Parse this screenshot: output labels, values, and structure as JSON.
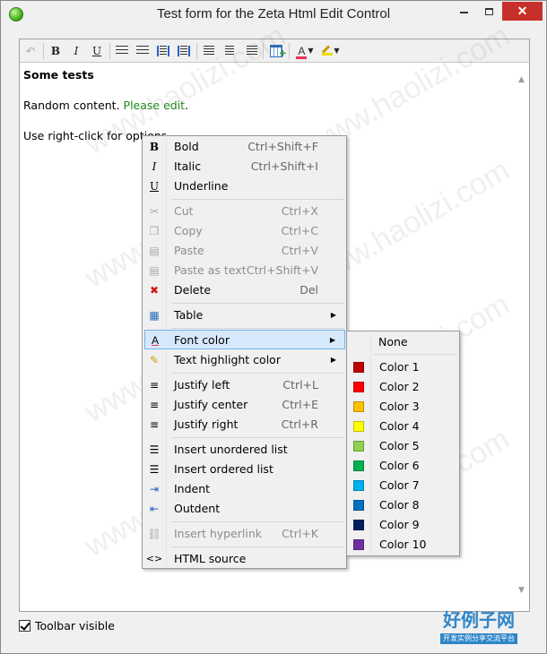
{
  "window": {
    "title": "Test form for the Zeta Html Edit Control",
    "close_glyph": "✕"
  },
  "editor": {
    "heading": "Some tests",
    "paragraph_prefix": "Random content. ",
    "paragraph_link": "Please edit",
    "paragraph_suffix": ".",
    "paragraph2": "Use right-click for options"
  },
  "toolbar": {
    "bold": "B",
    "italic": "I",
    "underline": "U",
    "font_color_letter": "A"
  },
  "footer": {
    "checkbox_label": "Toolbar visible",
    "checkbox_checked": true
  },
  "context_menu": {
    "items": [
      {
        "label": "Bold",
        "shortcut": "Ctrl+Shift+F",
        "icon": "B"
      },
      {
        "label": "Italic",
        "shortcut": "Ctrl+Shift+I",
        "icon": "I"
      },
      {
        "label": "Underline",
        "shortcut": "",
        "icon": "U"
      },
      {
        "label": "Cut",
        "shortcut": "Ctrl+X",
        "icon": "✂"
      },
      {
        "label": "Copy",
        "shortcut": "Ctrl+C",
        "icon": "❐"
      },
      {
        "label": "Paste",
        "shortcut": "Ctrl+V",
        "icon": "▤"
      },
      {
        "label": "Paste as text",
        "shortcut": "Ctrl+Shift+V",
        "icon": "▤"
      },
      {
        "label": "Delete",
        "shortcut": "Del",
        "icon": "✖"
      },
      {
        "label": "Table",
        "shortcut": "",
        "icon": "▦"
      },
      {
        "label": "Font color",
        "shortcut": "",
        "icon": "A"
      },
      {
        "label": "Text highlight color",
        "shortcut": "",
        "icon": "✎"
      },
      {
        "label": "Justify left",
        "shortcut": "Ctrl+L",
        "icon": "≡"
      },
      {
        "label": "Justify center",
        "shortcut": "Ctrl+E",
        "icon": "≡"
      },
      {
        "label": "Justify right",
        "shortcut": "Ctrl+R",
        "icon": "≡"
      },
      {
        "label": "Insert unordered list",
        "shortcut": "",
        "icon": "☰"
      },
      {
        "label": "Insert ordered list",
        "shortcut": "",
        "icon": "☰"
      },
      {
        "label": "Indent",
        "shortcut": "",
        "icon": "⇥"
      },
      {
        "label": "Outdent",
        "shortcut": "",
        "icon": "⇤"
      },
      {
        "label": "Insert hyperlink",
        "shortcut": "Ctrl+K",
        "icon": "⛓"
      },
      {
        "label": "HTML source",
        "shortcut": "",
        "icon": "<>"
      }
    ],
    "submenu_arrow": "▶"
  },
  "font_color_submenu": {
    "none_label": "None",
    "colors": [
      {
        "label": "Color 1",
        "hex": "#c00000"
      },
      {
        "label": "Color 2",
        "hex": "#ff0000"
      },
      {
        "label": "Color 3",
        "hex": "#ffc000"
      },
      {
        "label": "Color 4",
        "hex": "#ffff00"
      },
      {
        "label": "Color 5",
        "hex": "#92d050"
      },
      {
        "label": "Color 6",
        "hex": "#00b050"
      },
      {
        "label": "Color 7",
        "hex": "#00b0f0"
      },
      {
        "label": "Color 8",
        "hex": "#0070c0"
      },
      {
        "label": "Color 9",
        "hex": "#002060"
      },
      {
        "label": "Color 10",
        "hex": "#7030a0"
      }
    ]
  },
  "watermark": {
    "text": "www.haolizi.com",
    "brand_cn": "好例子网",
    "brand_sub": "开发实例分享交流平台"
  }
}
